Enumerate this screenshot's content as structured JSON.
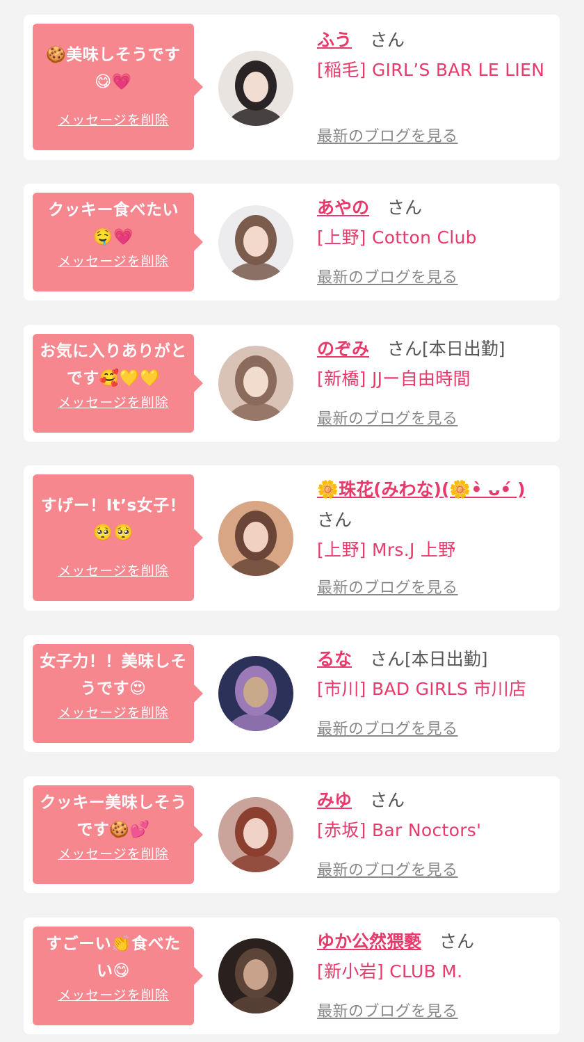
{
  "messages": [
    {
      "text": "🍪美味しそうです😋💗",
      "delete_label": "メッセージを削除",
      "name": "ふう",
      "honorific": "さん",
      "status": "",
      "shop": "[稲毛] GIRL’S BAR LE LIEN",
      "blog_label": "最新のブログを見る",
      "avatar_colors": [
        "#e9e4df",
        "#2a2426",
        "#f1ddd2"
      ]
    },
    {
      "text": "クッキー食べたい🤤💗",
      "delete_label": "メッセージを削除",
      "name": "あやの",
      "honorific": "さん",
      "status": "",
      "shop": "[上野] Cotton Club",
      "blog_label": "最新のブログを見る",
      "avatar_colors": [
        "#ecebee",
        "#7a5b4c",
        "#f3d9cc"
      ]
    },
    {
      "text": "お気に入りありがとです🥰💛💛",
      "delete_label": "メッセージを削除",
      "name": "のぞみ",
      "honorific": "さん",
      "status": "[本日出勤]",
      "shop": "[新橋] JJー自由時間",
      "blog_label": "最新のブログを見る",
      "avatar_colors": [
        "#d9c2b6",
        "#8a6a5b",
        "#f2dccd"
      ]
    },
    {
      "text": "すげー！It’s女子！🥺🥺",
      "delete_label": "メッセージを削除",
      "name": "🌼珠花(みわな)(🌼•̀ ᴗ•́ )",
      "honorific": "さん",
      "status": "",
      "shop": "[上野] Mrs.J 上野",
      "blog_label": "最新のブログを見る",
      "avatar_colors": [
        "#d8a684",
        "#6b4638",
        "#f1d1bf"
      ]
    },
    {
      "text": "女子力！！美味しそうです😍",
      "delete_label": "メッセージを削除",
      "name": "るな",
      "honorific": "さん",
      "status": "[本日出勤]",
      "shop": "[市川] BAD GIRLS 市川店",
      "blog_label": "最新のブログを見る",
      "avatar_colors": [
        "#2b3158",
        "#9c7ab8",
        "#c8a98a"
      ]
    },
    {
      "text": "クッキー美味しそうです🍪💕",
      "delete_label": "メッセージを削除",
      "name": "みゆ",
      "honorific": "さん",
      "status": "",
      "shop": "[赤坂] Bar Noctors'",
      "blog_label": "最新のブログを見る",
      "avatar_colors": [
        "#caa39a",
        "#8b3f2f",
        "#f0d3c6"
      ]
    },
    {
      "text": "すごーい👏食べたい😋",
      "delete_label": "メッセージを削除",
      "name": "ゆか公然猥褻",
      "honorific": "さん",
      "status": "",
      "shop": "[新小岩] CLUB M.",
      "blog_label": "最新のブログを見る",
      "avatar_colors": [
        "#2a211e",
        "#5d4438",
        "#c9a28b"
      ]
    }
  ]
}
